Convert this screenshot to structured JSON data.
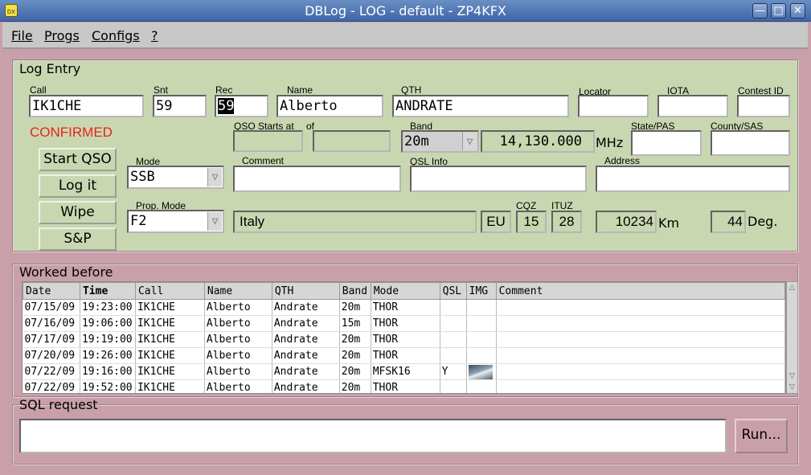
{
  "window": {
    "title": "DBLog - LOG - default - ZP4KFX",
    "icon_text": "DX",
    "controls": [
      "minimize-icon",
      "maximize-icon",
      "close-icon"
    ]
  },
  "menu": {
    "items": [
      {
        "label": "File"
      },
      {
        "label": "Progs"
      },
      {
        "label": "Configs"
      },
      {
        "label": "?"
      }
    ]
  },
  "log_entry": {
    "title": "Log Entry",
    "call_label": "Call",
    "call": "IK1CHE",
    "snt_label": "Snt",
    "snt": "59",
    "rec_label": "Rec",
    "rec": "59",
    "name_label": "Name",
    "name": "Alberto",
    "qth_label": "QTH",
    "qth": "ANDRATE",
    "locator_label": "Locator",
    "locator": "",
    "iota_label": "IOTA",
    "iota": "",
    "contest_label": "Contest ID",
    "contest": "",
    "status": "CONFIRMED",
    "status_color": "#e8231a",
    "qso_start_label": "QSO Starts at",
    "qso_start": "",
    "of_label": "of",
    "of": "",
    "band_label": "Band",
    "band": "20m",
    "freq": "14,130.000",
    "freq_unit": "MHz",
    "state_label": "State/PAS",
    "state": "",
    "county_label": "County/SAS",
    "county": "",
    "mode_label": "Mode",
    "mode": "SSB",
    "comment_label": "Comment",
    "comment": "",
    "qsl_info_label": "QSL Info",
    "qsl_info": "",
    "address_label": "Address",
    "address": "",
    "prop_mode_label": "Prop. Mode",
    "prop_mode": "F2",
    "country": "Italy",
    "continent": "EU",
    "cqz_label": "CQZ",
    "cqz": "15",
    "ituz_label": "ITUZ",
    "ituz": "28",
    "distance": "10234",
    "distance_unit": "Km",
    "bearing": "44",
    "bearing_unit": "Deg.",
    "buttons": {
      "start_qso": "Start QSO",
      "log_it": "Log it",
      "wipe": "Wipe",
      "sp": "S&P"
    }
  },
  "worked_before": {
    "title": "Worked before",
    "columns": [
      "Date",
      "Time",
      "Call",
      "Name",
      "QTH",
      "Band",
      "Mode",
      "QSL",
      "IMG",
      "Comment"
    ],
    "rows": [
      {
        "date": "07/15/09",
        "time": "19:23:00",
        "call": "IK1CHE",
        "name": "Alberto",
        "qth": "Andrate",
        "band": "20m",
        "mode": "THOR",
        "qsl": "",
        "img": false,
        "comment": ""
      },
      {
        "date": "07/16/09",
        "time": "19:06:00",
        "call": "IK1CHE",
        "name": "Alberto",
        "qth": "Andrate",
        "band": "15m",
        "mode": "THOR",
        "qsl": "",
        "img": false,
        "comment": ""
      },
      {
        "date": "07/17/09",
        "time": "19:19:00",
        "call": "IK1CHE",
        "name": "Alberto",
        "qth": "Andrate",
        "band": "20m",
        "mode": "THOR",
        "qsl": "",
        "img": false,
        "comment": ""
      },
      {
        "date": "07/20/09",
        "time": "19:26:00",
        "call": "IK1CHE",
        "name": "Alberto",
        "qth": "Andrate",
        "band": "20m",
        "mode": "THOR",
        "qsl": "",
        "img": false,
        "comment": ""
      },
      {
        "date": "07/22/09",
        "time": "19:16:00",
        "call": "IK1CHE",
        "name": "Alberto",
        "qth": "Andrate",
        "band": "20m",
        "mode": "MFSK16",
        "qsl": "Y",
        "img": true,
        "comment": ""
      },
      {
        "date": "07/22/09",
        "time": "19:52:00",
        "call": "IK1CHE",
        "name": "Alberto",
        "qth": "Andrate",
        "band": "20m",
        "mode": "THOR",
        "qsl": "",
        "img": false,
        "comment": ""
      }
    ]
  },
  "sql": {
    "title": "SQL request",
    "query": "",
    "run_label": "Run..."
  }
}
